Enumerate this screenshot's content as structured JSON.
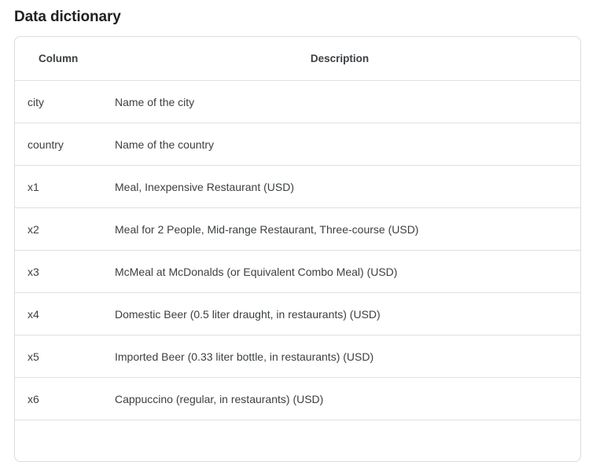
{
  "section": {
    "title": "Data dictionary"
  },
  "table": {
    "headers": [
      "Column",
      "Description"
    ],
    "rows": [
      {
        "column": "city",
        "description": "Name of the city"
      },
      {
        "column": "country",
        "description": "Name of the country"
      },
      {
        "column": "x1",
        "description": "Meal, Inexpensive Restaurant (USD)"
      },
      {
        "column": "x2",
        "description": "Meal for 2 People, Mid-range Restaurant, Three-course (USD)"
      },
      {
        "column": "x3",
        "description": "McMeal at McDonalds (or Equivalent Combo Meal) (USD)"
      },
      {
        "column": "x4",
        "description": "Domestic Beer (0.5 liter draught, in restaurants) (USD)"
      },
      {
        "column": "x5",
        "description": "Imported Beer (0.33 liter bottle, in restaurants) (USD)"
      },
      {
        "column": "x6",
        "description": "Cappuccino (regular, in restaurants) (USD)"
      }
    ]
  }
}
